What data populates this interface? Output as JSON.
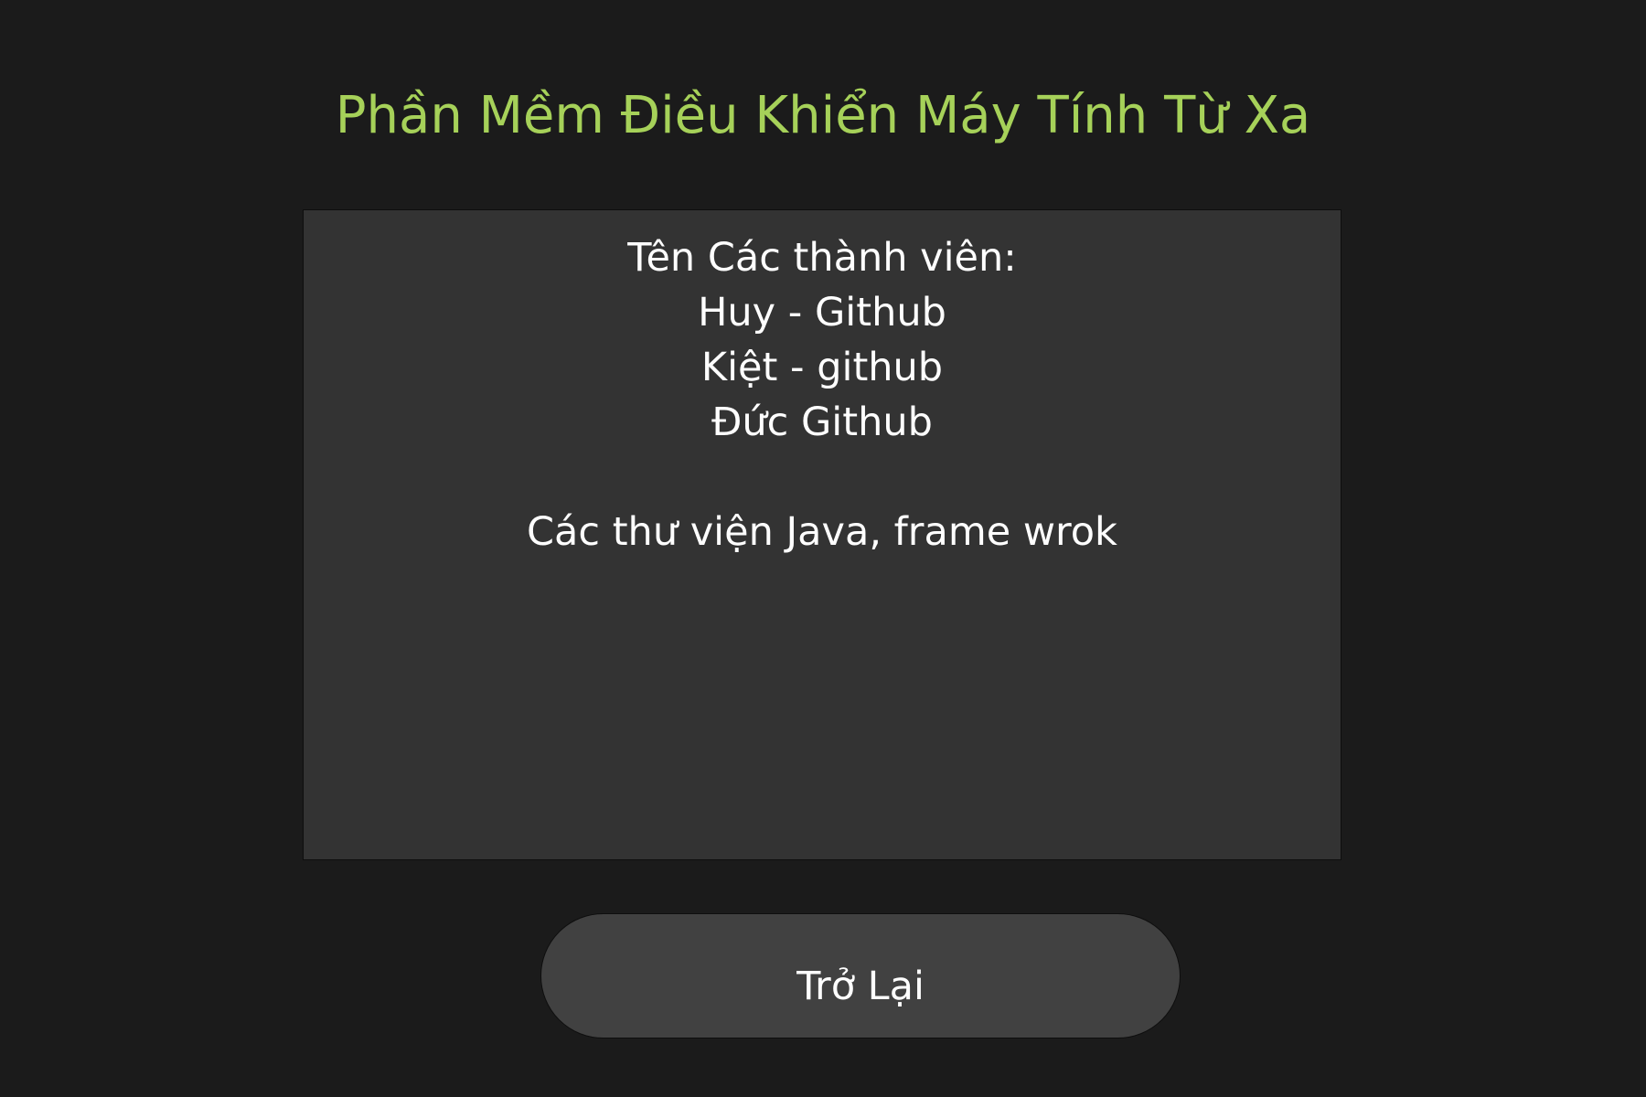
{
  "window": {
    "title": "Phần Mềm Điều Khiển Máy Tính Từ Xa"
  },
  "info": {
    "members_heading": "Tên Các thành viên:",
    "members": [
      "Huy - Github",
      "Kiệt - github",
      "Đức Github"
    ],
    "libraries": "Các thư viện Java, frame wrok"
  },
  "actions": {
    "back_label": "Trở Lại"
  },
  "colors": {
    "background": "#1b1b1b",
    "title": "#a6d159",
    "panel": "#333333",
    "button": "#414141",
    "text": "#ffffff"
  }
}
